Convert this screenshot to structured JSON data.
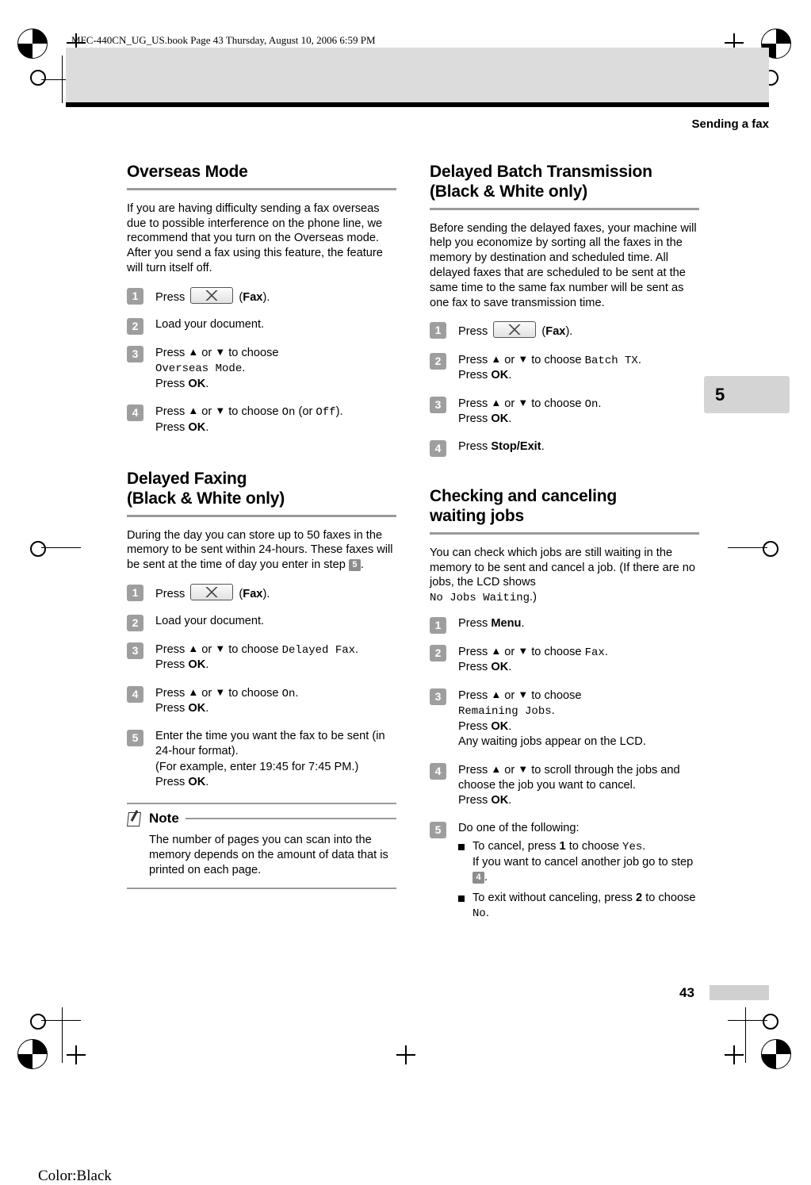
{
  "page": {
    "filestamp": "MFC-440CN_UG_US.book  Page 43  Thursday, August 10, 2006  6:59 PM",
    "running_head": "Sending a fax",
    "chapter_tab": "5",
    "page_number": "43",
    "color_mark": "Color:Black"
  },
  "left_column": {
    "section1": {
      "title": "Overseas Mode",
      "intro": "If you are having difficulty sending a fax overseas due to possible interference on the phone line, we recommend that you turn on the Overseas mode. After you send a fax using this feature, the feature will turn itself off.",
      "steps": [
        {
          "num": "1",
          "parts": [
            "Press ",
            "(",
            "Fax",
            ")."
          ]
        },
        {
          "num": "2",
          "text": "Load your document."
        },
        {
          "num": "3",
          "lead": "Press ",
          "mid": " or ",
          "tail": " to choose",
          "mono": "Overseas Mode",
          "after": ".",
          "press": "Press ",
          "key": "OK",
          "end": "."
        },
        {
          "num": "4",
          "lead": "Press ",
          "mid": " or ",
          "tail": " to choose ",
          "mono1": "On",
          "or": " (or ",
          "mono2": "Off",
          "close": ").",
          "press": "Press ",
          "key": "OK",
          "end": "."
        }
      ]
    },
    "section2": {
      "title_line1": "Delayed Faxing",
      "title_line2": "(Black & White only)",
      "intro_a": "During the day you can store up to 50 faxes in the memory to be sent within 24-hours. These faxes will be sent at the time of day you enter in step ",
      "intro_step": "5",
      "intro_b": ".",
      "steps": [
        {
          "num": "1",
          "text_pre": "Press ",
          "text_post": "(",
          "bold": "Fax",
          "text_end": ")."
        },
        {
          "num": "2",
          "text": "Load your document."
        },
        {
          "num": "3",
          "lead": "Press ",
          "mid": " or ",
          "tail": " to choose ",
          "mono": "Delayed Fax",
          "after": ".",
          "press": "Press ",
          "key": "OK",
          "end": "."
        },
        {
          "num": "4",
          "lead": "Press ",
          "mid": " or ",
          "tail": " to choose ",
          "mono": "On",
          "after": ".",
          "press": "Press ",
          "key": "OK",
          "end": "."
        },
        {
          "num": "5",
          "line1": "Enter the time you want the fax to be sent (in 24-hour format).",
          "line2": "(For example, enter 19:45 for 7:45 PM.)",
          "press": "Press ",
          "key": "OK",
          "end": "."
        }
      ],
      "note": {
        "title": "Note",
        "body": "The number of pages you can scan into the memory depends on the amount of data that is printed on each page."
      }
    }
  },
  "right_column": {
    "section1": {
      "title_line1": "Delayed Batch Transmission",
      "title_line2": "(Black & White only)",
      "intro": "Before sending the delayed faxes, your machine will help you economize by sorting all the faxes in the memory by destination and scheduled time. All delayed faxes that are scheduled to be sent at the same time to the same fax number will be sent as one fax to save transmission time.",
      "steps": [
        {
          "num": "1",
          "text_pre": "Press ",
          "text_post": "(",
          "bold": "Fax",
          "text_end": ")."
        },
        {
          "num": "2",
          "lead": "Press ",
          "mid": " or ",
          "tail": " to choose ",
          "mono": "Batch TX",
          "after": ".",
          "press": "Press ",
          "key": "OK",
          "end": "."
        },
        {
          "num": "3",
          "lead": "Press ",
          "mid": " or ",
          "tail": " to choose ",
          "mono": "On",
          "after": ".",
          "press": "Press ",
          "key": "OK",
          "end": "."
        },
        {
          "num": "4",
          "press": "Press ",
          "key": "Stop/Exit",
          "end": "."
        }
      ]
    },
    "section2": {
      "title_line1": "Checking and canceling",
      "title_line2": "waiting jobs",
      "intro_a": "You can check which jobs are still waiting in the memory to be sent and cancel a job. (If there are no jobs, the LCD shows ",
      "intro_mono": "No Jobs Waiting",
      "intro_b": ".)",
      "steps": [
        {
          "num": "1",
          "press": "Press ",
          "key": "Menu",
          "end": "."
        },
        {
          "num": "2",
          "lead": "Press ",
          "mid": " or ",
          "tail": " to choose ",
          "mono": "Fax",
          "after": ".",
          "press": "Press ",
          "key": "OK",
          "end": "."
        },
        {
          "num": "3",
          "lead": "Press ",
          "mid": " or ",
          "tail": " to choose",
          "mono": "Remaining Jobs",
          "after": ".",
          "press": "Press ",
          "key": "OK",
          "end": ".",
          "extra": "Any waiting jobs appear on the LCD."
        },
        {
          "num": "4",
          "lead": "Press ",
          "mid": " or ",
          "tail": " to scroll through the jobs and choose the job you want to cancel.",
          "press": "Press ",
          "key": "OK",
          "end": "."
        },
        {
          "num": "5",
          "text": "Do one of the following:",
          "bullets": [
            {
              "pre": "To cancel, press ",
              "bold": "1",
              "mid": " to choose ",
              "mono": "Yes",
              "post": ".",
              "line2_pre": "If you want to cancel another job go to step ",
              "step": "4",
              "line2_post": "."
            },
            {
              "pre": "To exit without canceling, press ",
              "bold": "2",
              "mid": " to choose ",
              "mono": "No",
              "post": "."
            }
          ]
        }
      ]
    }
  }
}
